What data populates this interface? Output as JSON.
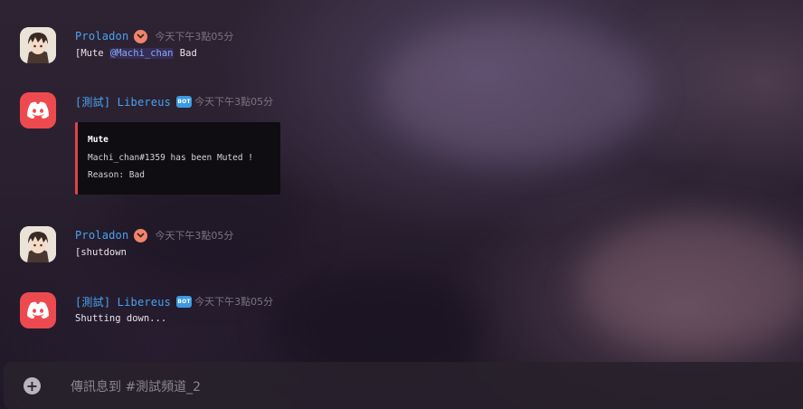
{
  "messages": [
    {
      "author": "Proladon",
      "timestamp": "今天下午3點05分",
      "content": {
        "command": "[Mute ",
        "mention": "@Machi_chan",
        "rest": " Bad"
      }
    },
    {
      "author": "[測試] Libereus",
      "bot_tag": "BOT",
      "timestamp": "今天下午3點05分",
      "embed": {
        "title": "Mute",
        "line1": "Machi_chan#1359 has been Muted !",
        "line2": "Reason: Bad"
      }
    },
    {
      "author": "Proladon",
      "timestamp": "今天下午3點05分",
      "content": "[shutdown"
    },
    {
      "author": "[測試] Libereus",
      "bot_tag": "BOT",
      "timestamp": "今天下午3點05分",
      "content": "Shutting down..."
    }
  ],
  "composer": {
    "placeholder": "傳訊息到 #測試頻道_2"
  },
  "colors": {
    "username": "#4aa3ef",
    "bot_avatar": "#ed4a4f",
    "embed_accent": "#e0424a",
    "owner_badge": "#f0846a"
  },
  "icons": {
    "owner_badge": "chevron-down-icon",
    "bot_avatar": "discord-logo-icon",
    "attach": "plus-icon"
  }
}
